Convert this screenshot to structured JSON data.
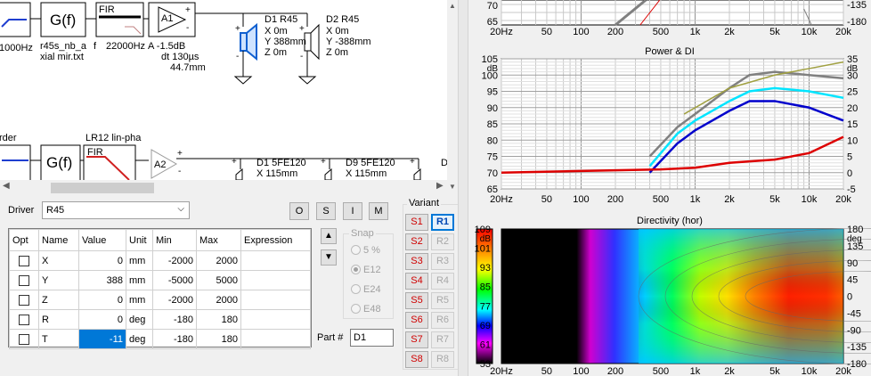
{
  "schematic": {
    "top_row": {
      "freq_left": "1000Hz",
      "gf_label": "G(f)",
      "gf_file_1": "r45s_nb_a",
      "gf_file_2": "xial mir.txt",
      "fir_label": "FIR",
      "fir_f": "f",
      "fir_freq": "22000Hz",
      "amp_label": "A1",
      "amp_info_1": "A  -1.5dB",
      "amp_info_2": "dt 130µs",
      "amp_info_3": "44.7mm",
      "d1_name": "D1 R45",
      "d1_x": "X 0m",
      "d1_y": "Y 388mm",
      "d1_z": "Z 0m",
      "d2_name": "D2 R45",
      "d2_x": "X 0m",
      "d2_y": "Y -388mm",
      "d2_z": "Z 0m"
    },
    "bottom_row": {
      "order_label": "rder",
      "gf_label": "G(f)",
      "lr_label": "LR12 lin-pha",
      "fir_label": "FIR",
      "amp_label": "A2",
      "d1_name": "D1 5FE120",
      "d1_x": "X 115mm",
      "d9_name": "D9 5FE120",
      "d9_x": "X 115mm",
      "d_trunc": "D"
    },
    "plus": "+",
    "minus": "-"
  },
  "driver_panel": {
    "driver_label": "Driver",
    "driver_value": "R45",
    "buttons": [
      "O",
      "S",
      "I",
      "M"
    ],
    "columns": [
      "Opt",
      "Name",
      "Value",
      "Unit",
      "Min",
      "Max",
      "Expression"
    ],
    "rows": [
      {
        "name": "X",
        "value": "0",
        "unit": "mm",
        "min": "-2000",
        "max": "2000"
      },
      {
        "name": "Y",
        "value": "388",
        "unit": "mm",
        "min": "-5000",
        "max": "5000"
      },
      {
        "name": "Z",
        "value": "0",
        "unit": "mm",
        "min": "-2000",
        "max": "2000"
      },
      {
        "name": "R",
        "value": "0",
        "unit": "deg",
        "min": "-180",
        "max": "180"
      },
      {
        "name": "T",
        "value": "-11",
        "unit": "deg",
        "min": "-180",
        "max": "180"
      }
    ],
    "snap_title": "Snap",
    "snap_options": [
      "5 %",
      "E12",
      "E24",
      "E48"
    ],
    "part_label": "Part #",
    "part_value": "D1",
    "variant_title": "Variant",
    "variant_s": [
      "S1",
      "S2",
      "S3",
      "S4",
      "S5",
      "S6",
      "S7",
      "S8"
    ],
    "variant_r": [
      "R1",
      "R2",
      "R3",
      "R4",
      "R5",
      "R6",
      "R7",
      "R8"
    ]
  },
  "charts": {
    "x_ticks": [
      "20Hz",
      "50",
      "100",
      "200",
      "500",
      "1k",
      "2k",
      "5k",
      "10k",
      "20k"
    ],
    "top_partial": {
      "y_labels": [
        "70",
        "65"
      ],
      "y_right": [
        "-135",
        "-180"
      ]
    },
    "power_di": {
      "title": "Power & DI",
      "y_left": [
        "105",
        "100",
        "95",
        "90",
        "85",
        "80",
        "75",
        "70",
        "65"
      ],
      "y_left_unit": "dB",
      "y_right": [
        "35",
        "30",
        "25",
        "20",
        "15",
        "10",
        "5",
        "0",
        "-5"
      ],
      "y_right_unit": "dB"
    },
    "directivity": {
      "title": "Directivity (hor)",
      "scale": [
        "109",
        "101",
        "93",
        "85",
        "77",
        "69",
        "61",
        "53"
      ],
      "scale_unit": "dB",
      "y_right": [
        "180",
        "135",
        "90",
        "45",
        "0",
        "-45",
        "-90",
        "-135",
        "-180"
      ],
      "y_right_unit": "deg"
    }
  },
  "chart_data": [
    {
      "type": "line",
      "title": "Power & DI",
      "x_scale": "log",
      "xlim": [
        20,
        20000
      ],
      "ylim": [
        65,
        105
      ],
      "y2lim": [
        -5,
        35
      ],
      "grid": true,
      "series": [
        {
          "color": "#808080",
          "x": [
            400,
            700,
            1000,
            2000,
            3000,
            5000,
            10000,
            20000
          ],
          "y": [
            75,
            84,
            88,
            96,
            100,
            101,
            100,
            99
          ]
        },
        {
          "color": "#00e5ff",
          "x": [
            400,
            700,
            1000,
            2000,
            3000,
            5000,
            10000,
            20000
          ],
          "y": [
            72,
            82,
            86,
            92,
            95,
            96,
            95,
            93
          ]
        },
        {
          "color": "#0000cc",
          "x": [
            400,
            700,
            1000,
            2000,
            3000,
            5000,
            10000,
            20000
          ],
          "y": [
            70,
            79,
            83,
            89,
            92,
            92,
            90,
            86
          ]
        },
        {
          "color": "#dd0000",
          "x": [
            20,
            100,
            500,
            1000,
            2000,
            5000,
            10000,
            20000
          ],
          "y": [
            70,
            70.5,
            71,
            71.5,
            73,
            74,
            76,
            81
          ]
        },
        {
          "color": "#a0a040",
          "x": [
            800,
            2000,
            5000,
            10000,
            20000
          ],
          "y": [
            88,
            96,
            100,
            102,
            104
          ]
        }
      ]
    },
    {
      "type": "heatmap",
      "title": "Directivity (hor)",
      "x_scale": "log",
      "xlim": [
        20,
        20000
      ],
      "ylim": [
        -180,
        180
      ],
      "zlim": [
        53,
        109
      ]
    }
  ]
}
